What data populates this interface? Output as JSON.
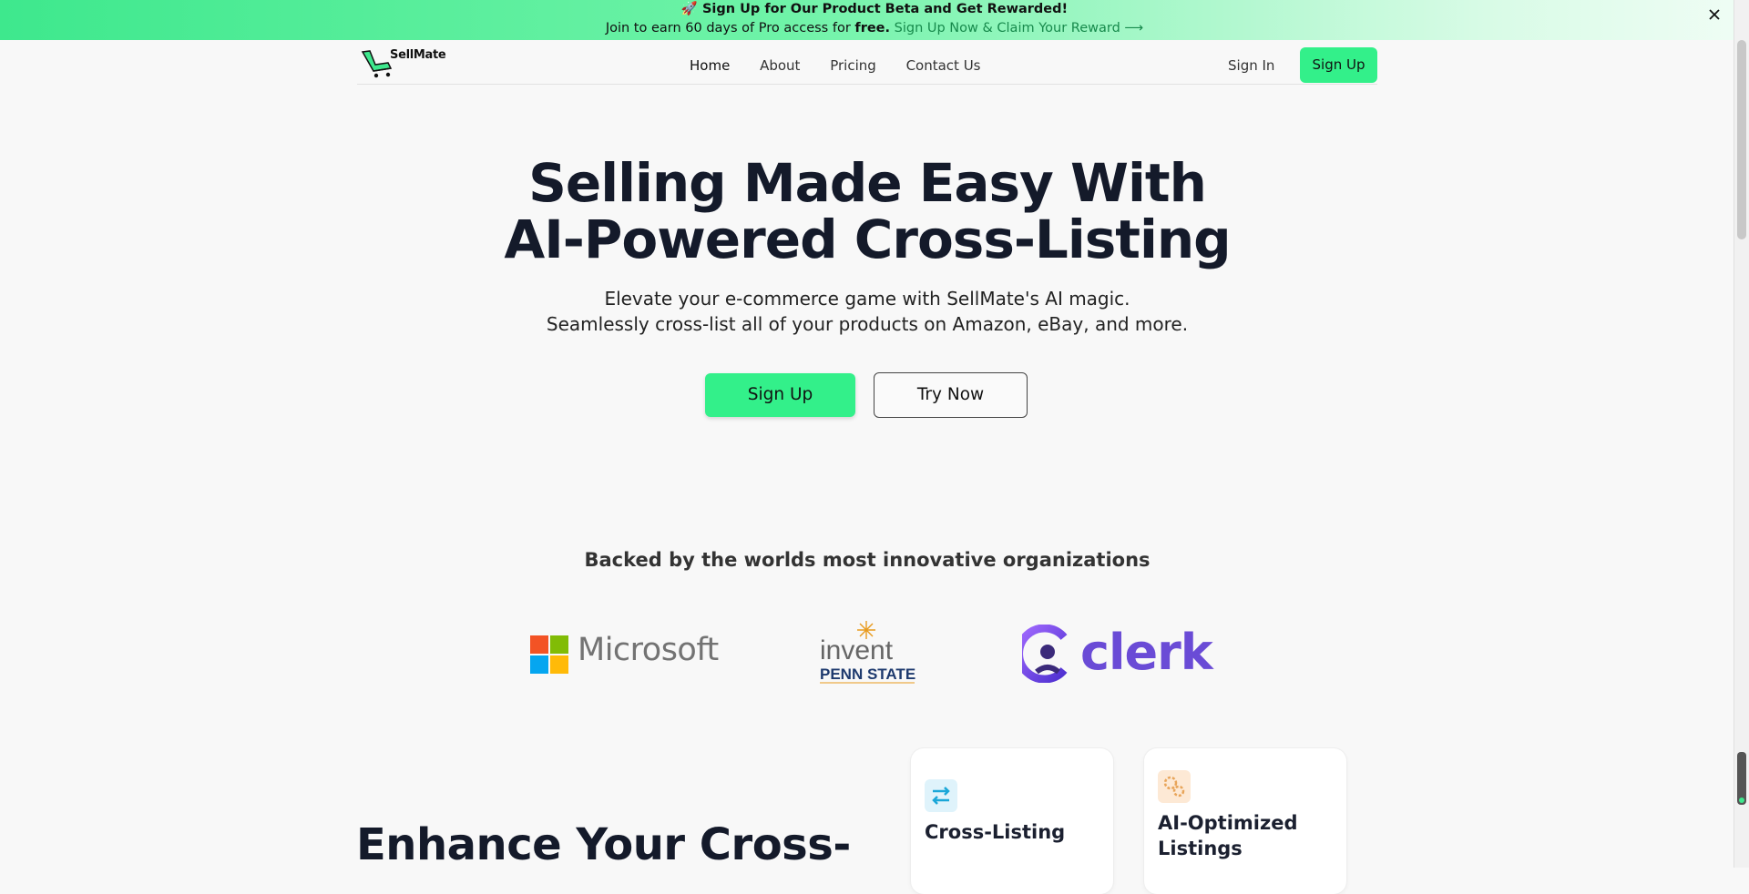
{
  "banner": {
    "line1": "🚀 Sign Up for Our Product Beta and Get Rewarded!",
    "line2_prefix": "Join to earn 60 days of Pro access for ",
    "line2_bold": "free.",
    "line2_cta": "Sign Up Now & Claim Your Reward ⟶"
  },
  "nav": {
    "brand": "SellMate",
    "links": [
      "Home",
      "About",
      "Pricing",
      "Contact Us"
    ],
    "sign_in": "Sign In",
    "sign_up": "Sign Up"
  },
  "hero": {
    "title_line1": "Selling Made Easy With",
    "title_line2": "AI-Powered Cross-Listing",
    "subtitle_line1": "Elevate your e-commerce game with SellMate's AI magic.",
    "subtitle_line2": "Seamlessly cross-list all of your products on Amazon, eBay, and more.",
    "primary_button": "Sign Up",
    "secondary_button": "Try Now"
  },
  "backed": {
    "heading": "Backed by the worlds most innovative organizations",
    "logos": {
      "microsoft": "Microsoft",
      "psu": "invent PENN STATE",
      "clerk": "clerk"
    }
  },
  "features": {
    "heading": "Enhance Your Cross-",
    "cards": [
      {
        "title": "Cross-Listing",
        "icon": "swap-arrows-icon"
      },
      {
        "title": "AI-Optimized Listings",
        "icon": "gears-icon"
      }
    ]
  },
  "colors": {
    "accent": "#33f08a",
    "banner_start": "#3ee88d",
    "heading": "#141a2a",
    "clerk": "#6a4bd6"
  }
}
